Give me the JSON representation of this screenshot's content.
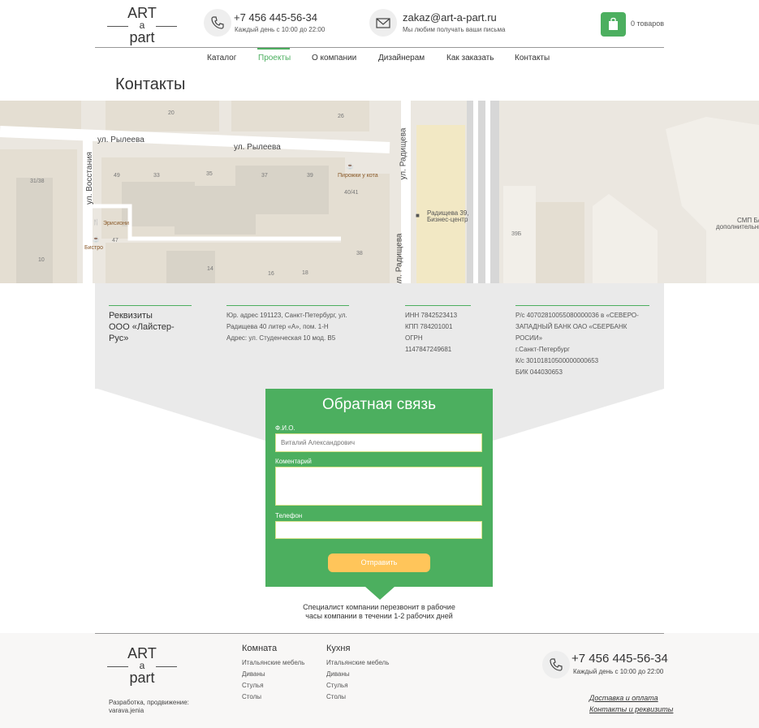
{
  "header": {
    "logo": {
      "line1": "ART",
      "line2": "a",
      "line3": "part"
    },
    "phone": {
      "number": "+7 456 445-56-34",
      "hours": "Каждый день с 10:00 до 22:00"
    },
    "email": {
      "address": "zakaz@art-a-part.ru",
      "note": "Мы любим получать ваши письма"
    },
    "cart": {
      "count_label": "0 товаров"
    }
  },
  "nav": {
    "items": [
      {
        "label": "Каталог"
      },
      {
        "label": "Проекты",
        "active": true
      },
      {
        "label": "О компании"
      },
      {
        "label": "Дизайнерам"
      },
      {
        "label": "Как заказать"
      },
      {
        "label": "Контакты"
      }
    ]
  },
  "page": {
    "title": "Контакты"
  },
  "map": {
    "streets": [
      "ул. Рылеева",
      "ул. Рылеева",
      "ул. Восстания",
      "ул. Радищева",
      "ул. Радищева"
    ],
    "pois": [
      "Пирожки у кота",
      "Радищева 39,",
      "Бизнес-центр",
      "Эрисиони",
      "Бистро",
      "СМП БАНК",
      "дополнительный офис"
    ],
    "numbers": [
      "20",
      "26",
      "31/38",
      "49",
      "33",
      "35",
      "37",
      "39",
      "40/41",
      "47",
      "10",
      "14",
      "16",
      "18",
      "38",
      "39Б"
    ]
  },
  "requisites": {
    "company": {
      "label": "Реквизиты",
      "name": "ООО «Лайстер-Рус»"
    },
    "address": {
      "legal": "Юр. адрес 191123, Санкт-Петербург, ул.",
      "legal2": "Радищева 40 литер «А», пом. 1-Н",
      "actual": "Адрес: ул. Студенческая 10 мод. В5"
    },
    "codes": {
      "inn": "ИНН 7842523413",
      "kpp": "КПП 784201001",
      "ogrn": "ОГРН 1147847249681"
    },
    "bank": {
      "line1": "Р/с 40702810055080000036 в «СЕВЕРО-",
      "line2": "ЗАПАДНЫЙ БАНК ОАО «СБЕРБАНК РОСИИ»",
      "line3": "г.Санкт-Петербург",
      "ks": "К/с 30101810500000000653",
      "bik": "БИК 044030653"
    }
  },
  "feedback": {
    "title": "Обратная связь",
    "fio_label": "Ф.И.О.",
    "fio_placeholder": "Виталий Александрович",
    "comment_label": "Коментарий",
    "phone_label": "Телефон",
    "submit_label": "Отправить",
    "note_line1": "Специалист компании перезвонит в рабочие",
    "note_line2": "часы компании в течении 1-2 рабочих дней"
  },
  "footer": {
    "logo": {
      "line1": "ART",
      "line2": "a",
      "line3": "part"
    },
    "credit_line1": "Разработка, продвижение:",
    "credit_line2": "varava.jenia",
    "room": {
      "title": "Комната",
      "links": [
        "Итальянские мебель",
        "Диваны",
        "Стулья",
        "Столы"
      ]
    },
    "kitchen": {
      "title": "Кухня",
      "links": [
        "Итальянские мебель",
        "Диваны",
        "Стулья",
        "Столы"
      ]
    },
    "phone": {
      "number": "+7 456 445-56-34",
      "hours": "Каждый день с 10:00 до 22:00"
    },
    "links": {
      "delivery": "Доставка и оплата",
      "contacts": "Контакты и реквизиты"
    }
  },
  "colors": {
    "accent": "#4caf5f",
    "button": "#ffc55a"
  }
}
